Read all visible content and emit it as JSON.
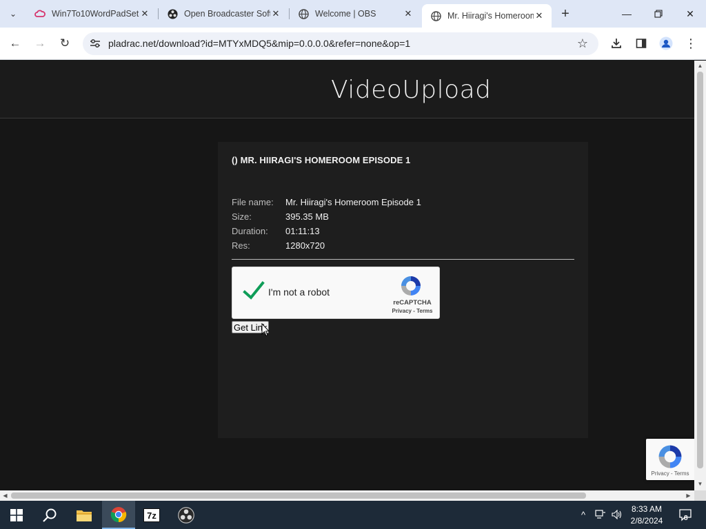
{
  "browser": {
    "tabs": [
      {
        "title": "Win7To10WordPadSet",
        "icon": "cloud-icon",
        "active": false
      },
      {
        "title": "Open Broadcaster Soft",
        "icon": "obs-icon",
        "active": false
      },
      {
        "title": "Welcome | OBS",
        "icon": "globe-icon",
        "active": false
      },
      {
        "title": "Mr. Hiiragi's Homeroom",
        "icon": "globe-icon",
        "active": true
      }
    ],
    "url": "pladrac.net/download?id=MTYxMDQ5&mip=0.0.0.0&refer=none&op=1"
  },
  "site": {
    "logo_light": "Video",
    "logo_bold": "Upload"
  },
  "card": {
    "title": "() MR. HIIRAGI'S HOMEROOM EPISODE 1",
    "fields": [
      {
        "label": "File name:",
        "value": "Mr. Hiiragi's Homeroom Episode 1"
      },
      {
        "label": "Size:",
        "value": "395.35 MB"
      },
      {
        "label": "Duration:",
        "value": "01:11:13"
      },
      {
        "label": "Res:",
        "value": "1280x720"
      }
    ],
    "get_link_label": "Get Link"
  },
  "recaptcha": {
    "label": "I'm not a robot",
    "brand": "reCAPTCHA",
    "links": "Privacy - Terms",
    "checked": true
  },
  "taskbar": {
    "time": "8:33 AM",
    "date": "2/8/2024",
    "notification_count": "8",
    "apps": [
      "start-icon",
      "search-icon",
      "file-explorer-icon",
      "chrome-icon",
      "7zip-icon",
      "obs-icon"
    ],
    "sevenzip_label": "7z"
  },
  "colors": {
    "tabstrip": "#dfe7f6",
    "page_bg": "#161616",
    "card_bg": "#1e1e1e",
    "check_green": "#0f9d58",
    "taskbar": "#1d2a38"
  }
}
